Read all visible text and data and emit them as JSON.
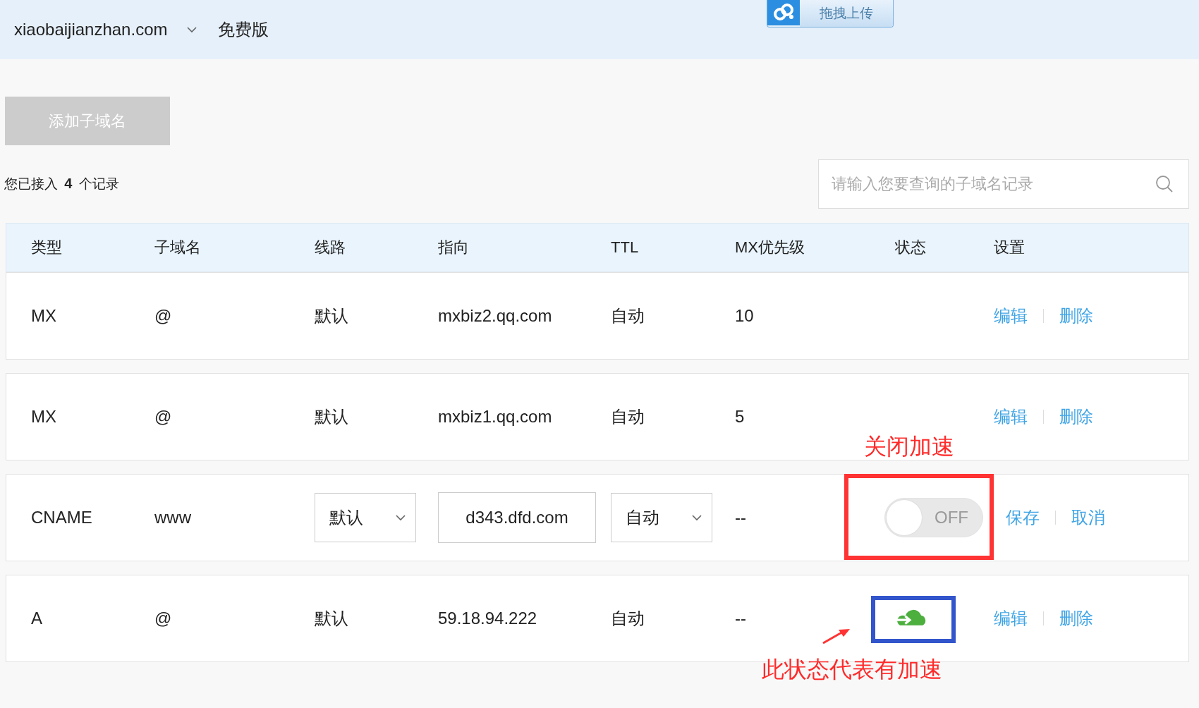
{
  "top_bar": {
    "domain": "xiaobaijianzhan.com",
    "plan": "免费版",
    "upload_button": "拖拽上传"
  },
  "add_button": "添加子域名",
  "summary": "您已接入 **4** 个记录",
  "search": {
    "placeholder": "请输入您要查询的子域名记录"
  },
  "table": {
    "columns": [
      "类型",
      "子域名",
      "线路",
      "指向",
      "TTL",
      "MX优先级",
      "状态",
      "设置"
    ],
    "rows": [
      {
        "kind": "view",
        "type": "MX",
        "subdomain": "@",
        "line": "默认",
        "target": "mxbiz2.qq.com",
        "ttl": "自动",
        "mx_priority": "10",
        "accelerated": false,
        "actions": [
          "编辑",
          "删除"
        ]
      },
      {
        "kind": "view",
        "type": "MX",
        "subdomain": "@",
        "line": "默认",
        "target": "mxbiz1.qq.com",
        "ttl": "自动",
        "mx_priority": "5",
        "accelerated": false,
        "actions": [
          "编辑",
          "删除"
        ]
      },
      {
        "kind": "edit",
        "type": "CNAME",
        "subdomain": "www",
        "line": "默认",
        "target": "d343.dfd.com",
        "ttl": "自动",
        "mx_priority": "--",
        "switch": {
          "on": false,
          "label": "OFF"
        },
        "actions": [
          "保存",
          "取消"
        ]
      },
      {
        "kind": "view",
        "type": "A",
        "subdomain": "@",
        "line": "默认",
        "target": "59.18.94.222",
        "ttl": "自动",
        "mx_priority": "--",
        "accelerated": true,
        "actions": [
          "编辑",
          "删除"
        ]
      }
    ]
  },
  "annotations": [
    {
      "kind": "label",
      "text": "关闭加速"
    },
    {
      "kind": "box",
      "color": "#ff3333"
    },
    {
      "kind": "box",
      "color": "#3355cc"
    },
    {
      "kind": "arrow"
    },
    {
      "kind": "label",
      "text": "此状态代表有加速"
    }
  ]
}
